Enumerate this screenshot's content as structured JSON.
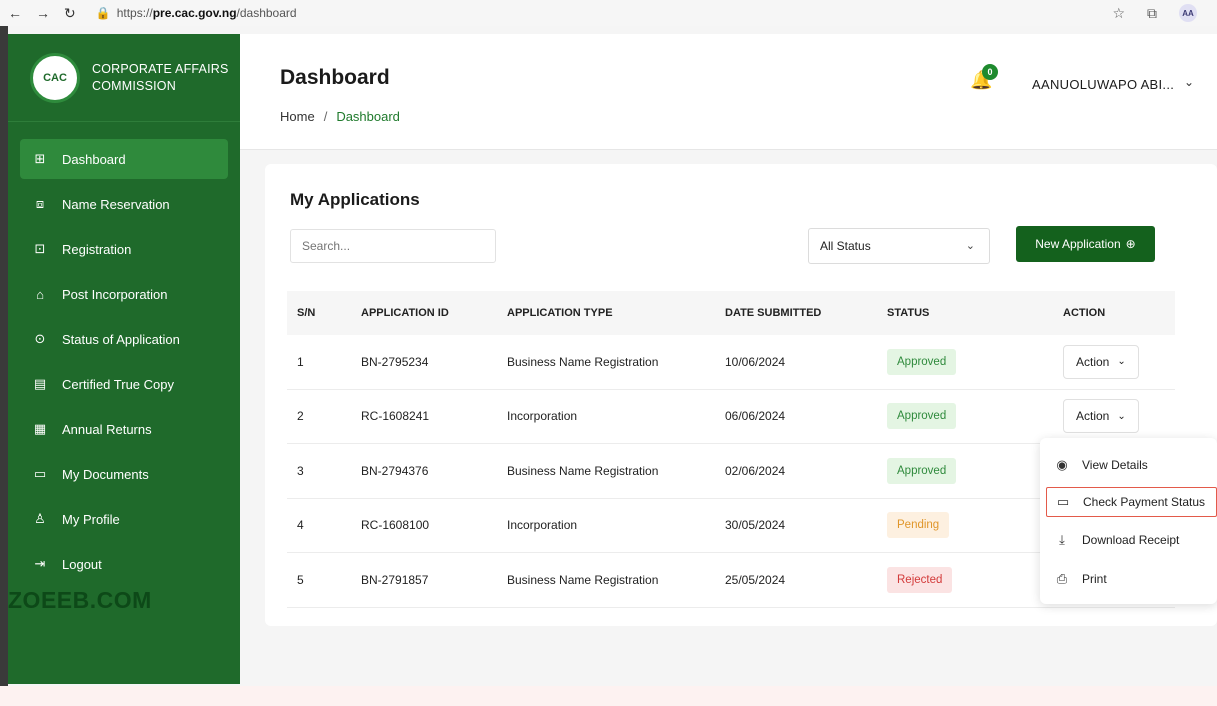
{
  "browser": {
    "url_prefix": "https://",
    "url_domain": "pre.cac.gov.ng",
    "url_path": "/dashboard",
    "profile_initials": "AA"
  },
  "sidebar": {
    "logo_text": "CAC",
    "brand_line1": "CORPORATE AFFAIRS",
    "brand_line2": "COMMISSION",
    "items": [
      {
        "label": "Dashboard",
        "icon": "grid-icon"
      },
      {
        "label": "Name Reservation",
        "icon": "search-box-icon"
      },
      {
        "label": "Registration",
        "icon": "registration-icon"
      },
      {
        "label": "Post Incorporation",
        "icon": "bank-icon"
      },
      {
        "label": "Status of Application",
        "icon": "magnifier-icon"
      },
      {
        "label": "Certified True Copy",
        "icon": "document-icon"
      },
      {
        "label": "Annual Returns",
        "icon": "calendar-icon"
      },
      {
        "label": "My Documents",
        "icon": "folder-icon"
      },
      {
        "label": "My Profile",
        "icon": "user-icon"
      },
      {
        "label": "Logout",
        "icon": "logout-icon"
      }
    ],
    "watermark": "ZOEEB.COM"
  },
  "header": {
    "title": "Dashboard",
    "breadcrumb_home": "Home",
    "breadcrumb_sep": "/",
    "breadcrumb_current": "Dashboard",
    "notification_count": "0",
    "user_name": "AANUOLUWAPO ABI..."
  },
  "applications": {
    "title": "My Applications",
    "search_placeholder": "Search...",
    "status_filter": "All Status",
    "new_button": "New Application",
    "columns": [
      "S/N",
      "APPLICATION ID",
      "APPLICATION TYPE",
      "DATE SUBMITTED",
      "STATUS",
      "ACTION"
    ],
    "rows": [
      {
        "sn": "1",
        "id": "BN-2795234",
        "type": "Business Name Registration",
        "date": "10/06/2024",
        "status": "Approved",
        "action": "Action"
      },
      {
        "sn": "2",
        "id": "RC-1608241",
        "type": "Incorporation",
        "date": "06/06/2024",
        "status": "Approved",
        "action": "Action"
      },
      {
        "sn": "3",
        "id": "BN-2794376",
        "type": "Business Name Registration",
        "date": "02/06/2024",
        "status": "Approved",
        "action": ""
      },
      {
        "sn": "4",
        "id": "RC-1608100",
        "type": "Incorporation",
        "date": "30/05/2024",
        "status": "Pending",
        "action": ""
      },
      {
        "sn": "5",
        "id": "BN-2791857",
        "type": "Business Name Registration",
        "date": "25/05/2024",
        "status": "Rejected",
        "action": ""
      }
    ]
  },
  "action_menu": {
    "items": [
      {
        "label": "View Details",
        "icon": "eye-icon"
      },
      {
        "label": "Check Payment Status",
        "icon": "card-icon"
      },
      {
        "label": "Download Receipt",
        "icon": "download-icon"
      },
      {
        "label": "Print",
        "icon": "printer-icon"
      }
    ]
  },
  "colors": {
    "sidebar": "#1f6a2b",
    "active_item": "#2f8a3c",
    "primary_button": "#14611d",
    "approved": "#2f8a3c",
    "pending": "#e0962a",
    "rejected": "#d33a3a",
    "highlight": "#e35a4a"
  }
}
